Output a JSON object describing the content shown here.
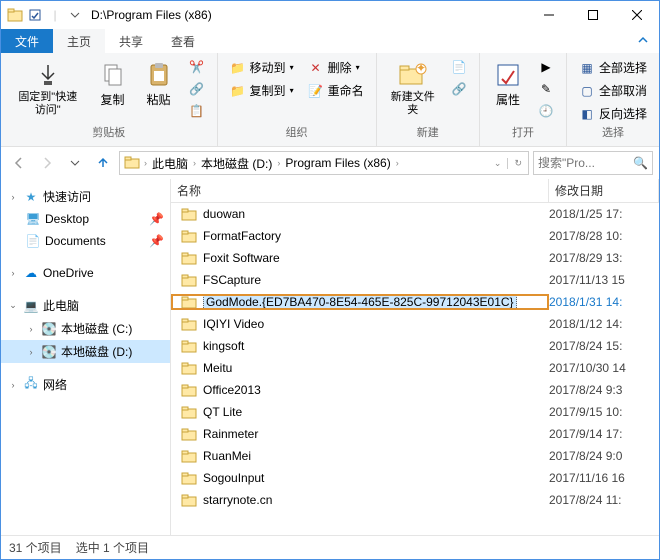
{
  "title": "D:\\Program Files (x86)",
  "tabs": {
    "file": "文件",
    "home": "主页",
    "share": "共享",
    "view": "查看"
  },
  "ribbon": {
    "clipboard": {
      "label": "剪贴板",
      "pin": "固定到\"快速访问\"",
      "copy": "复制",
      "paste": "粘贴"
    },
    "organize": {
      "label": "组织",
      "moveTo": "移动到",
      "copyTo": "复制到",
      "delete": "删除",
      "rename": "重命名"
    },
    "new": {
      "label": "新建",
      "newFolder": "新建文件夹"
    },
    "open": {
      "label": "打开",
      "properties": "属性"
    },
    "select": {
      "label": "选择",
      "selectAll": "全部选择",
      "selectNone": "全部取消",
      "invert": "反向选择"
    }
  },
  "breadcrumbs": [
    {
      "label": "此电脑"
    },
    {
      "label": "本地磁盘 (D:)"
    },
    {
      "label": "Program Files (x86)"
    }
  ],
  "search_placeholder": "搜索\"Pro...",
  "tree": {
    "quick": "快速访问",
    "desktop": "Desktop",
    "documents": "Documents",
    "onedrive": "OneDrive",
    "thispc": "此电脑",
    "driveC": "本地磁盘 (C:)",
    "driveD": "本地磁盘 (D:)",
    "network": "网络"
  },
  "columns": {
    "name": "名称",
    "modified": "修改日期"
  },
  "files": [
    {
      "name": "duowan",
      "date": "2018/1/25 17:"
    },
    {
      "name": "FormatFactory",
      "date": "2017/8/28 10:"
    },
    {
      "name": "Foxit Software",
      "date": "2017/8/29 13:"
    },
    {
      "name": "FSCapture",
      "date": "2017/11/13 15"
    },
    {
      "name": "GodMode.{ED7BA470-8E54-465E-825C-99712043E01C}",
      "date": "2018/1/31 14:",
      "highlighted": true
    },
    {
      "name": "IQIYI Video",
      "date": "2018/1/12 14:"
    },
    {
      "name": "kingsoft",
      "date": "2017/8/24 15:"
    },
    {
      "name": "Meitu",
      "date": "2017/10/30 14"
    },
    {
      "name": "Office2013",
      "date": "2017/8/24 9:3"
    },
    {
      "name": "QT Lite",
      "date": "2017/9/15 10:"
    },
    {
      "name": "Rainmeter",
      "date": "2017/9/14 17:"
    },
    {
      "name": "RuanMei",
      "date": "2017/8/24 9:0"
    },
    {
      "name": "SogouInput",
      "date": "2017/11/16 16"
    },
    {
      "name": "starrynote.cn",
      "date": "2017/8/24 11:"
    }
  ],
  "status": {
    "count": "31 个项目",
    "selected": "选中 1 个项目"
  }
}
